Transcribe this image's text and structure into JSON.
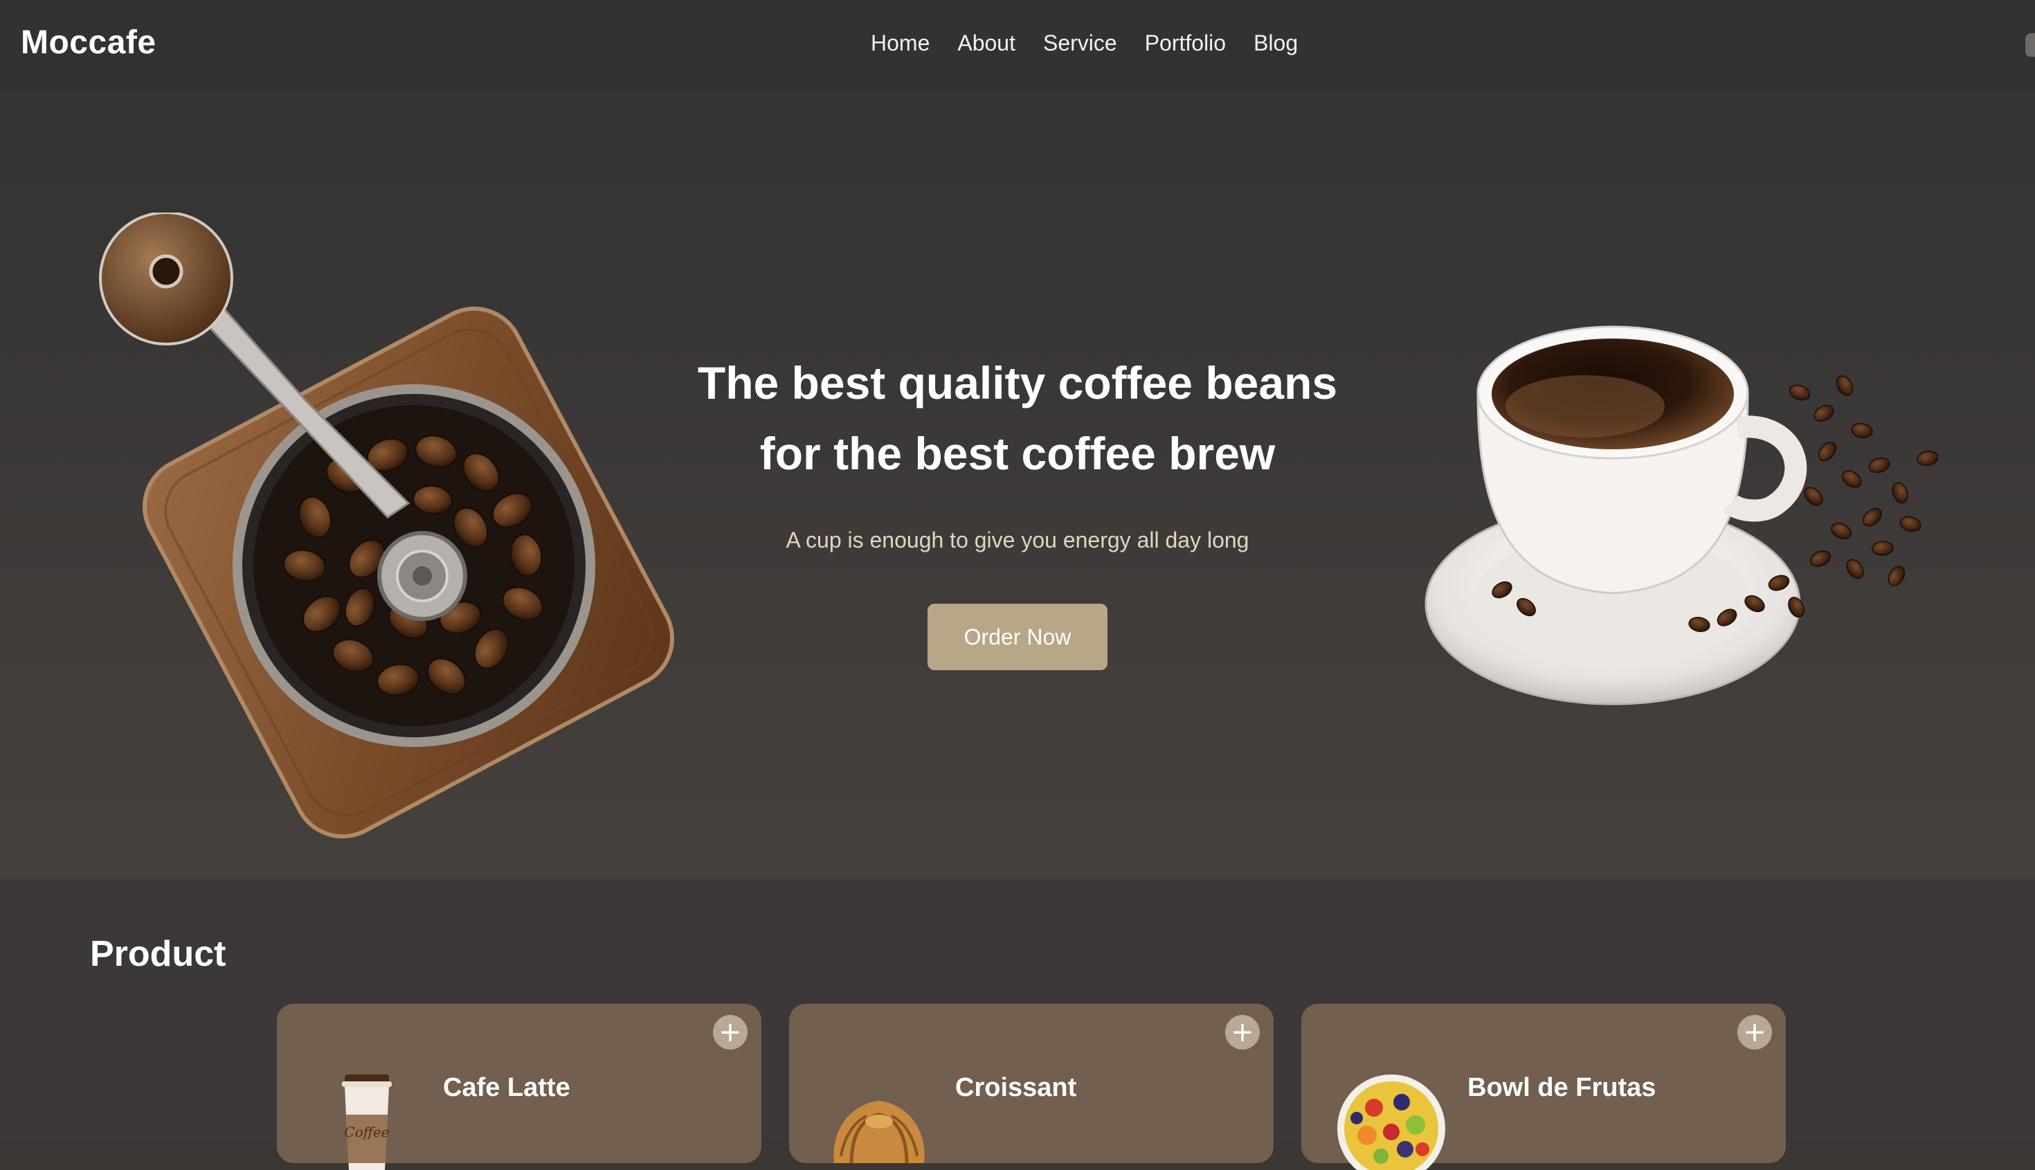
{
  "brand": "Moccafe",
  "nav": {
    "items": [
      "Home",
      "About",
      "Service",
      "Portfolio",
      "Blog"
    ]
  },
  "hero": {
    "title_line1": "The best quality coffee beans",
    "title_line2": "for the best coffee brew",
    "subtitle": "A cup is enough to give you energy all day long",
    "cta_label": "Order Now"
  },
  "product": {
    "heading": "Product",
    "items": [
      {
        "name": "Cafe Latte",
        "icon": "coffee-cup-icon",
        "cup_text": "Coffee"
      },
      {
        "name": "Croissant",
        "icon": "croissant-icon"
      },
      {
        "name": "Bowl de Frutas",
        "icon": "fruit-bowl-icon"
      }
    ],
    "add_symbol": "+"
  },
  "colors": {
    "nav_bg": "#333232",
    "accent": "#b8a689",
    "card_bg": "#725f4f",
    "subtitle": "#e4d5bf"
  }
}
